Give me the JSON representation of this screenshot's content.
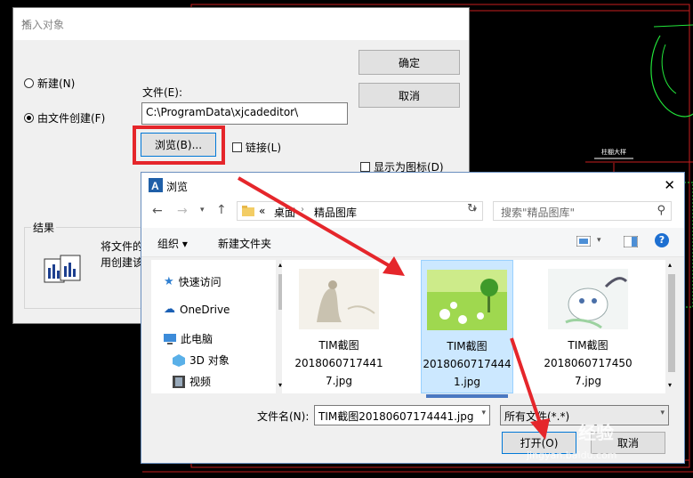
{
  "insert_dialog": {
    "title": "插入对象",
    "close": "✕",
    "radio_new": "新建(N)",
    "radio_from_file": "由文件创建(F)",
    "file_label": "文件(E):",
    "file_path": "C:\\ProgramData\\xjcadeditor\\",
    "browse_button": "浏览(B)...",
    "link_label": "链接(L)",
    "display_icon_label": "显示为图标(D)",
    "ok_button": "确定",
    "cancel_button": "取消",
    "result_label": "结果",
    "result_text_1": "将文件的",
    "result_text_2": "用创建该"
  },
  "browse_dialog": {
    "title": "浏览",
    "close": "✕",
    "breadcrumb": [
      "«",
      "桌面",
      "精品图库"
    ],
    "search_placeholder": "搜索\"精品图库\"",
    "organize": "组织 ▾",
    "new_folder": "新建文件夹",
    "help": "?",
    "nav_items": [
      {
        "label": "快速访问",
        "icon": "star-icon"
      },
      {
        "label": "OneDrive",
        "icon": "cloud-icon"
      },
      {
        "label": "此电脑",
        "icon": "computer-icon"
      },
      {
        "label": "3D 对象",
        "icon": "cube-icon"
      },
      {
        "label": "视频",
        "icon": "video-icon"
      }
    ],
    "files": [
      {
        "name_l1": "TIM截图",
        "name_l2": "2018060717441",
        "name_l3": "7.jpg"
      },
      {
        "name_l1": "TIM截图",
        "name_l2": "2018060717444",
        "name_l3": "1.jpg"
      },
      {
        "name_l1": "TIM截图",
        "name_l2": "2018060717450",
        "name_l3": "7.jpg"
      }
    ],
    "filename_label": "文件名(N):",
    "filename_value": "TIM截图20180607174441.jpg",
    "filter_value": "所有文件(*.*)",
    "open_button": "打开(O)",
    "cancel_button": "取消"
  },
  "cad": {
    "small_label": "柱棚大样"
  },
  "watermark": {
    "text": "经验",
    "url": "jingyan.baidu.com"
  },
  "colors": {
    "annotation_red": "#e5262b",
    "cad_green": "#22e53a",
    "cad_red": "#c81e1e",
    "selection_blue": "#cce8ff"
  }
}
